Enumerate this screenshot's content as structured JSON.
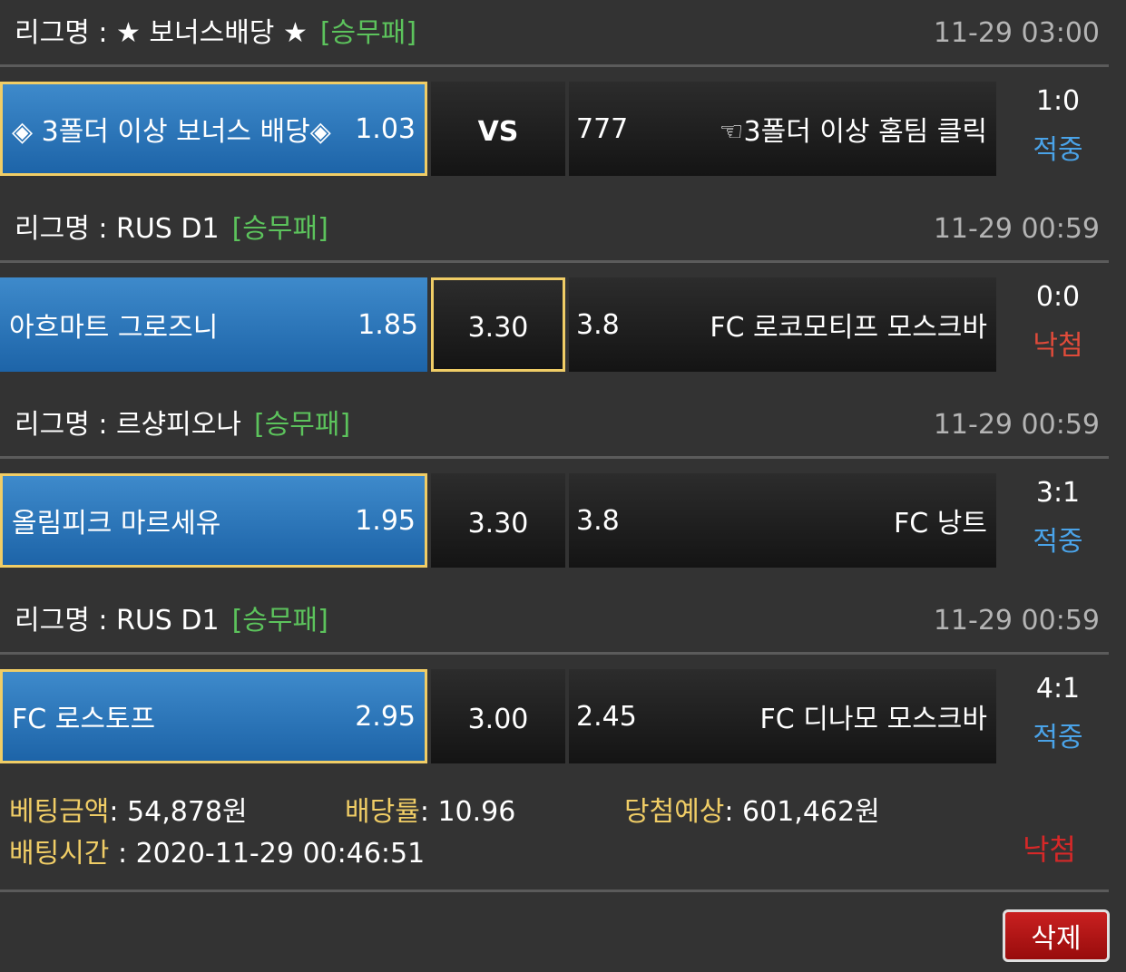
{
  "matches": [
    {
      "league_label": "리그명 : ★ 보너스배당 ★",
      "bet_type": "[승무패]",
      "time": "11-29 03:00",
      "home_name": "◈ 3폴더 이상 보너스 배당◈",
      "home_odds": "1.03",
      "draw": "VS",
      "away_odds": "777",
      "away_name": "☜3폴더 이상 홈팀 클릭",
      "score": "1:0",
      "result": "적중"
    },
    {
      "league_label": "리그명 : RUS D1",
      "bet_type": "[승무패]",
      "time": "11-29 00:59",
      "home_name": "아흐마트 그로즈니",
      "home_odds": "1.85",
      "draw": "3.30",
      "away_odds": "3.8",
      "away_name": "FC 로코모티프 모스크바",
      "score": "0:0",
      "result": "낙첨"
    },
    {
      "league_label": "리그명 : 르샹피오나",
      "bet_type": "[승무패]",
      "time": "11-29 00:59",
      "home_name": "올림피크 마르세유",
      "home_odds": "1.95",
      "draw": "3.30",
      "away_odds": "3.8",
      "away_name": "FC 낭트",
      "score": "3:1",
      "result": "적중"
    },
    {
      "league_label": "리그명 : RUS D1",
      "bet_type": "[승무패]",
      "time": "11-29 00:59",
      "home_name": "FC 로스토프",
      "home_odds": "2.95",
      "draw": "3.00",
      "away_odds": "2.45",
      "away_name": "FC 디나모 모스크바",
      "score": "4:1",
      "result": "적중"
    }
  ],
  "summary": {
    "bet_amount_label": "베팅금액",
    "bet_amount": ": 54,878원",
    "odds_label": "배당률",
    "odds": ": 10.96",
    "expected_label": "당첨예상",
    "expected": ": 601,462원",
    "bet_time_label": "배팅시간",
    "bet_time": " : 2020-11-29 00:46:51",
    "result": "낙첨"
  },
  "delete_label": "삭제",
  "colors": {
    "background": "#333333",
    "home_blue": "#2a75bb",
    "selected_border": "#f0cd66",
    "bet_type_green": "#5cc35c",
    "hit_blue": "#4aa3e8",
    "miss_red": "#e04b3a",
    "delete_red": "#b31515"
  }
}
